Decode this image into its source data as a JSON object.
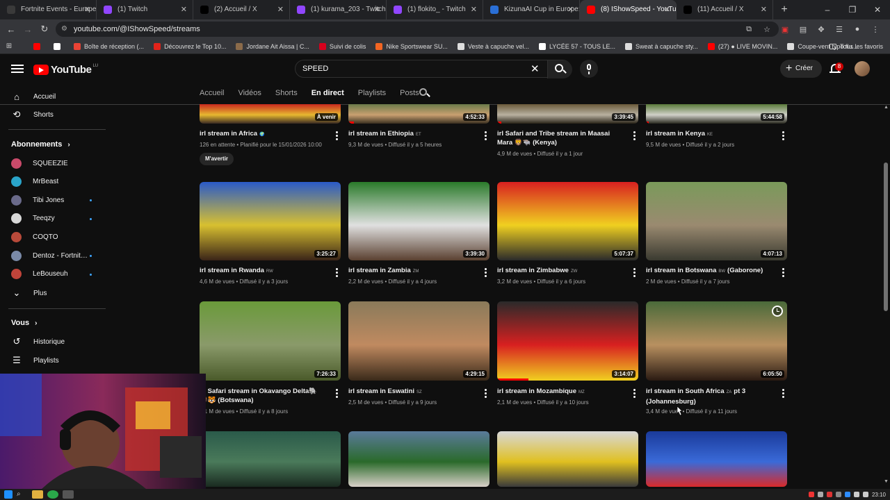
{
  "browser": {
    "tabs": [
      {
        "title": "Fortnite Events - Europe",
        "icon": "fortnite-icon",
        "color": "#3a3a3a"
      },
      {
        "title": "(1) Twitch",
        "icon": "twitch-icon",
        "color": "#9146ff"
      },
      {
        "title": "(2) Accueil / X",
        "icon": "x-icon",
        "color": "#000000"
      },
      {
        "title": "(1) kurama_203 - Twitch",
        "icon": "twitch-icon",
        "color": "#9146ff"
      },
      {
        "title": "(1) flokito_ - Twitch",
        "icon": "twitch-icon",
        "color": "#9146ff"
      },
      {
        "title": "KizunaAI Cup in Europe: S",
        "icon": "tournament-icon",
        "color": "#2a6fd6"
      },
      {
        "title": "(8) IShowSpeed - YouTube",
        "icon": "youtube-icon",
        "color": "#ff0000",
        "active": true
      },
      {
        "title": "(11) Accueil / X",
        "icon": "x-icon",
        "color": "#000000"
      }
    ],
    "url": "youtube.com/@IShowSpeed/streams",
    "bookmarks": [
      {
        "label": "",
        "color": "#ff0000"
      },
      {
        "label": "",
        "color": "#ffffff"
      },
      {
        "label": "Boîte de réception (...",
        "color": "#ea4335"
      },
      {
        "label": "Découvrez le Top 10...",
        "color": "#e2231a"
      },
      {
        "label": "Jordane Ait Aissa | C...",
        "color": "#8b6b4a"
      },
      {
        "label": "Suivi de colis",
        "color": "#d6001c"
      },
      {
        "label": "Nike Sportswear SU...",
        "color": "#f26522"
      },
      {
        "label": "Veste à capuche vel...",
        "color": "#dddddd"
      },
      {
        "label": "LYCÉE 57 - TOUS LE...",
        "color": "#ffffff"
      },
      {
        "label": "Sweat à capuche sty...",
        "color": "#dddddd"
      },
      {
        "label": "(27) ● LIVE MOVIN...",
        "color": "#ff0000"
      },
      {
        "label": "Coupe-vent typo flu...",
        "color": "#dddddd"
      }
    ],
    "all_favorites": "Tous les favoris"
  },
  "youtube": {
    "logo_text": "YouTube",
    "country_code": "LU",
    "search_value": "SPEED",
    "create_label": "Créer",
    "notif_count": "8"
  },
  "sidebar": {
    "main": [
      {
        "label": "Accueil",
        "icon": "home-icon"
      },
      {
        "label": "Shorts",
        "icon": "shorts-icon"
      }
    ],
    "subs_title": "Abonnements",
    "subs": [
      {
        "label": "SQUEEZIE",
        "color": "#c94a6a",
        "live": false
      },
      {
        "label": "MrBeast",
        "color": "#2aa4c9",
        "live": false
      },
      {
        "label": "Tibi Jones",
        "color": "#6a6a8a",
        "live": true
      },
      {
        "label": "Teeqzy",
        "color": "#d8d8d8",
        "live": true
      },
      {
        "label": "COQTO",
        "color": "#b84a3a",
        "live": false
      },
      {
        "label": "Dentoz - Fortnite ...",
        "color": "#7a8aa8",
        "live": true
      },
      {
        "label": "LeBouseuh",
        "color": "#c0443a",
        "live": true
      }
    ],
    "more_label": "Plus",
    "you_title": "Vous",
    "you": [
      {
        "label": "Historique",
        "icon": "history-icon"
      },
      {
        "label": "Playlists",
        "icon": "playlists-icon"
      }
    ]
  },
  "channel_tabs": [
    "Accueil",
    "Vidéos",
    "Shorts",
    "En direct",
    "Playlists",
    "Posts"
  ],
  "selected_tab": "En direct",
  "remind_label": "M'avertir",
  "videos": [
    {
      "title": "irl stream in Africa",
      "flag": "🌍",
      "meta": "126 en attente • Planifié pour le 15/01/2026 10:00",
      "duration": "À venir",
      "progress": 0
    },
    {
      "title": "irl stream in Ethiopia",
      "flag": "ET",
      "meta": "9,3 M de vues • Diffusé il y a 5 heures",
      "duration": "4:52:33",
      "progress": 0.04
    },
    {
      "title": "irl Safari and Tribe stream in Maasai Mara 🦁🐃 (Kenya)",
      "flag": "",
      "meta": "4,9 M de vues • Diffusé il y a 1 jour",
      "duration": "3:39:45",
      "progress": 0.03
    },
    {
      "title": "irl stream in Kenya",
      "flag": "KE",
      "meta": "9,5 M de vues • Diffusé il y a 2 jours",
      "duration": "5:44:58",
      "progress": 0.02
    },
    {
      "title": "irl stream in Rwanda",
      "flag": "RW",
      "meta": "4,6 M de vues • Diffusé il y a 3 jours",
      "duration": "3:25:27",
      "progress": 0
    },
    {
      "title": "irl stream in Zambia",
      "flag": "ZM",
      "meta": "2,2 M de vues • Diffusé il y a 4 jours",
      "duration": "3:39:30",
      "progress": 0
    },
    {
      "title": "irl stream in Zimbabwe",
      "flag": "ZW",
      "meta": "3,2 M de vues • Diffusé il y a 6 jours",
      "duration": "5:07:37",
      "progress": 0
    },
    {
      "title": "irl stream in Botswana",
      "flag": "BW",
      "extra": "(Gaborone)",
      "meta": "2 M de vues • Diffusé il y a 7 jours",
      "duration": "4:07:13",
      "progress": 0
    },
    {
      "title": "irl Safari stream in Okavango Delta🐘🦁🐯 (Botswana)",
      "flag": "",
      "meta": "2,1 M de vues • Diffusé il y a 8 jours",
      "duration": "7:26:33",
      "progress": 0
    },
    {
      "title": "irl stream in Eswatini",
      "flag": "SZ",
      "meta": "2,5 M de vues • Diffusé il y a 9 jours",
      "duration": "4:29:15",
      "progress": 0
    },
    {
      "title": "irl stream in Mozambique",
      "flag": "MZ",
      "meta": "2,1 M de vues • Diffusé il y a 10 jours",
      "duration": "3:14:07",
      "progress": 0.22
    },
    {
      "title": "irl stream in South Africa",
      "flag": "ZA",
      "extra": "pt 3 (Johannesburg)",
      "meta": "3,4 M de vues • Diffusé il y a 11 jours",
      "duration": "6:05:50",
      "progress": 0
    },
    {
      "title": "",
      "meta": "",
      "duration": "",
      "progress": 0
    },
    {
      "title": "",
      "meta": "",
      "duration": "",
      "progress": 0
    },
    {
      "title": "",
      "meta": "",
      "duration": "",
      "progress": 0
    },
    {
      "title": "",
      "meta": "",
      "duration": "",
      "progress": 0
    }
  ],
  "taskbar": {
    "clock": "23:10"
  },
  "colors": {
    "accent_red": "#ff0000",
    "bg": "#0f0f0f",
    "live_dot": "#3ea6ff"
  }
}
